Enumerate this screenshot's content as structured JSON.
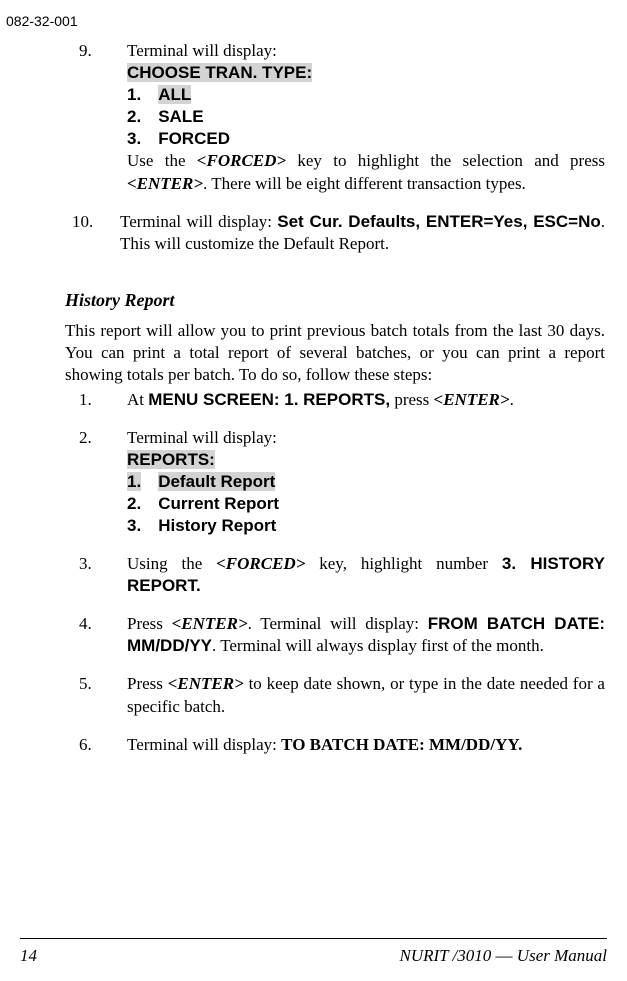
{
  "header": {
    "doc_id": "082-32-001"
  },
  "step9": {
    "num": "9.",
    "intro": "Terminal will display:",
    "line1": "CHOOSE TRAN. TYPE:",
    "line2a": "1.",
    "line2b": "ALL",
    "line3a": "2.",
    "line3b": "SALE",
    "line4a": "3.",
    "line4b": "FORCED",
    "body1": "Use the ",
    "forced": "<FORCED>",
    "body2": " key to highlight the selection and press ",
    "enter": "<ENTER>",
    "body3": ".  There will be eight different transaction types."
  },
  "step10": {
    "num": "10.",
    "body1": "Terminal will display: ",
    "bold1": "Set Cur. Defaults, ENTER=Yes, ESC=No",
    "body2": ". This will customize the Default Report."
  },
  "section": {
    "heading": "History Report"
  },
  "intro_para": "This report will allow you to print previous batch totals from the last 30 days.  You can print a total report of several batches, or you can print a report showing totals per batch.  To do so, follow these steps:",
  "h1": {
    "num": "1.",
    "t1": "At ",
    "bold": "MENU SCREEN: 1. REPORTS,",
    "t2": " press ",
    "enter": "<ENTER>",
    "t3": "."
  },
  "h2": {
    "num": "2.",
    "intro": "Terminal will display:",
    "line1": "REPORTS:",
    "line2a": "1.",
    "line2b": "Default Report",
    "line3a": "2.",
    "line3b": "Current Report",
    "line4a": "3.",
    "line4b": "History Report"
  },
  "h3": {
    "num": "3.",
    "t1": "Using the ",
    "forced": "<FORCED>",
    "t2": " key, highlight number ",
    "bold": "3. HISTORY REPORT."
  },
  "h4": {
    "num": "4.",
    "t1": "Press ",
    "enter": "<ENTER>",
    "t2": ". Terminal will display:  ",
    "bold": "FROM BATCH DATE: MM/DD/YY",
    "t3": ".  Terminal will always display first of the month."
  },
  "h5": {
    "num": "5.",
    "t1": "Press ",
    "enter": "<ENTER>",
    "t2": " to keep date shown, or type in the date needed for a specific batch."
  },
  "h6": {
    "num": "6.",
    "t1": "Terminal will display: ",
    "bold": "TO BATCH DATE: MM/DD/YY."
  },
  "footer": {
    "page": "14",
    "title_prefix": "NURIT /3010 ",
    "emdash": "—",
    "title_suffix": " User Manual"
  }
}
